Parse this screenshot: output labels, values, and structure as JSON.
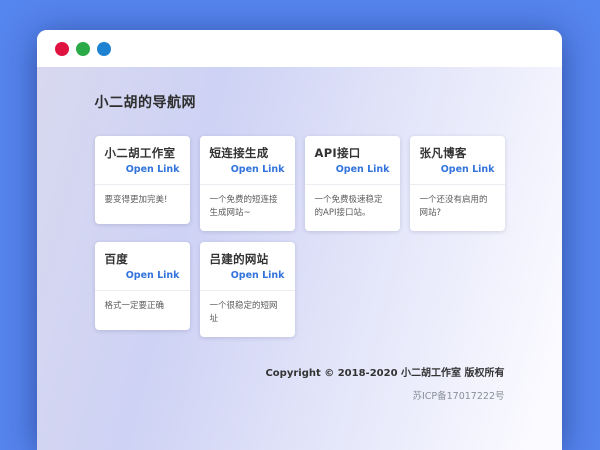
{
  "window": {
    "dot_colors": {
      "close": "#e01240",
      "minimize": "#2aab47",
      "maximize": "#1d82d2"
    }
  },
  "page": {
    "title": "小二胡的导航网"
  },
  "cards": [
    {
      "title": "小二胡工作室",
      "link": "Open Link",
      "description": "要变得更加完美!"
    },
    {
      "title": "短连接生成",
      "link": "Open Link",
      "description": "一个免费的短连接生成网站~"
    },
    {
      "title": "API接口",
      "link": "Open Link",
      "description": "一个免费极速稳定的API接口站。"
    },
    {
      "title": "张凡博客",
      "link": "Open Link",
      "description": "一个还没有启用的网站?"
    },
    {
      "title": "百度",
      "link": "Open Link",
      "description": "格式一定要正确"
    },
    {
      "title": "吕建的网站",
      "link": "Open Link",
      "description": "一个很稳定的短网址"
    }
  ],
  "footer": {
    "copyright": "Copyright © 2018-2020 小二胡工作室 版权所有",
    "icp": "苏ICP备17017222号"
  },
  "colors": {
    "outer_background": "#5585ee",
    "content_gradient_left": "#d3d5f1",
    "content_gradient_right": "#fafaff",
    "link_blue": "#3273dc",
    "title_text": "#2e2e2e",
    "body_text": "#5c5c5c"
  }
}
